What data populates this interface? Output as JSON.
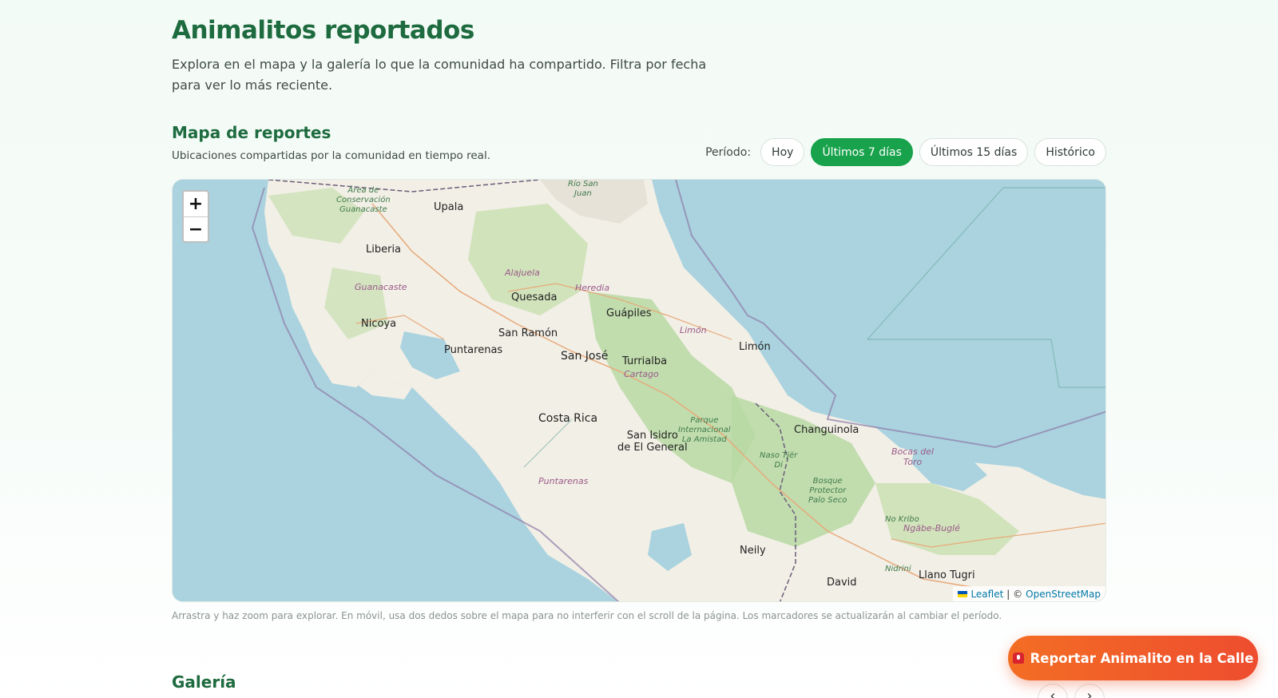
{
  "header": {
    "title": "Animalitos reportados",
    "description": "Explora en el mapa y la galería lo que la comunidad ha compartido. Filtra por fecha para ver lo más reciente."
  },
  "map_section": {
    "title": "Mapa de reportes",
    "subtitle": "Ubicaciones compartidas por la comunidad en tiempo real.",
    "period_label": "Período:",
    "periods": [
      "Hoy",
      "Últimos 7 días",
      "Últimos 15 días",
      "Histórico"
    ],
    "active_period": "Últimos 7 días",
    "zoom_in": "+",
    "zoom_out": "−",
    "attribution": {
      "leaflet": "Leaflet",
      "separator": "| ©",
      "osm": "OpenStreetMap"
    },
    "labels": {
      "country": "Costa Rica",
      "capital": "San José",
      "cities": [
        "Upala",
        "Liberia",
        "Quesada",
        "Nicoya",
        "San Ramón",
        "Puntarenas",
        "Guápiles",
        "Turrialba",
        "Limón",
        "San Isidro",
        "de El General",
        "Changuinola",
        "Neily",
        "David",
        "Llano Tugri"
      ],
      "regions": [
        "Guanacaste",
        "Alajuela",
        "Heredia",
        "Cartago",
        "Limón",
        "Puntarenas",
        "Bocas del",
        "Toro",
        "Ngäbe-Buglé"
      ],
      "parks": [
        "Área de",
        "Conservación",
        "Guanacaste",
        "Río San",
        "Juan",
        "Parque",
        "Internacional",
        "La Amistad",
        "Naso Tjër",
        "Di",
        "Bosque",
        "Protector",
        "Palo Seco",
        "No Kribo",
        "Nidrini"
      ]
    },
    "note": "Arrastra y haz zoom para explorar. En móvil, usa dos dedos sobre el mapa para no interferir con el scroll de la página. Los marcadores se actualizarán al cambiar el período."
  },
  "gallery": {
    "title": "Galería",
    "prev": "‹",
    "next": "›"
  },
  "report_button": {
    "label": "Reportar Animalito en la Calle",
    "icon": "siren-icon"
  },
  "colors": {
    "brand_green": "#1d6b3f",
    "active_pill": "#17a24b",
    "cta_start": "#f36d24",
    "cta_end": "#ee4d2f",
    "water": "#a9d3df",
    "land": "#f2efe6",
    "forest": "#b9d9a3"
  }
}
